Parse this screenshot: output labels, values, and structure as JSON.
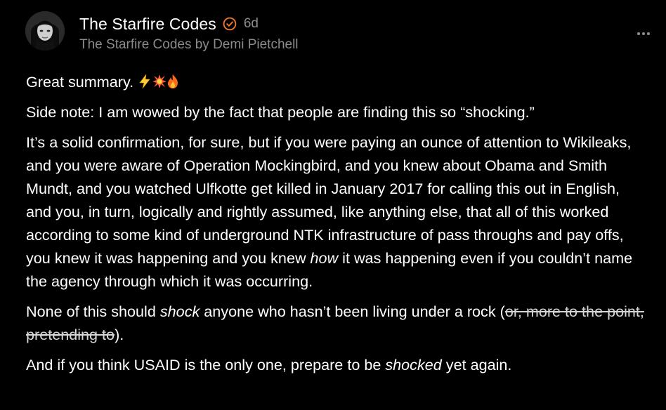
{
  "header": {
    "author_name": "The Starfire Codes",
    "timestamp": "6d",
    "publication": "The Starfire Codes by Demi Pietchell",
    "verified_icon": "verified-check-icon",
    "more_icon": "more-horizontal-icon"
  },
  "colors": {
    "background": "#000000",
    "text": "#ffffff",
    "muted": "#8c8c8c",
    "accent": "#f07a2c"
  },
  "comment": {
    "p1": "Great summary.",
    "p1_emojis": [
      "lightning-emoji",
      "collision-emoji",
      "fire-emoji"
    ],
    "p2": "Side note: I am wowed by the fact that people are finding this so “shocking.”",
    "p3_a": "It’s a solid confirmation, for sure, but if you were paying an ounce of attention to Wikileaks, and you were aware of Operation Mockingbird, and you knew about Obama and Smith Mundt, and you watched Ulfkotte get killed in January 2017 for calling this out in English, and you, in turn, logically and rightly assumed, like anything else, that all of this worked according to some kind of underground NTK infrastructure of pass throughs and pay offs, you knew it was happening and you knew ",
    "p3_em": "how",
    "p3_b": " it was happening even if you couldn’t name the agency through which it was occurring.",
    "p4_a": "None of this should ",
    "p4_em": "shock",
    "p4_b": " anyone who hasn’t been living under a rock (",
    "p4_strike": "or, more to the point, pretending to",
    "p4_c": ").",
    "p5_a": "And if you think USAID is the only one, prepare to be ",
    "p5_em": "shocked",
    "p5_b": " yet again."
  }
}
